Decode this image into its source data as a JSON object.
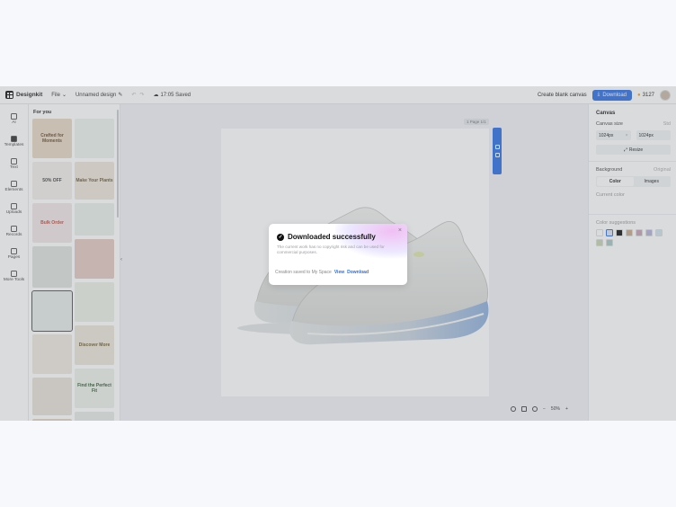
{
  "topbar": {
    "brand": "Designkit",
    "file_menu": "File",
    "doc_title": "Unnamed design",
    "save_status": "17:05 Saved",
    "create_blank": "Create blank canvas",
    "download": "Download",
    "credits": "3127"
  },
  "rail": {
    "items": [
      {
        "label": "AI",
        "icon": "ai-icon"
      },
      {
        "label": "Templates",
        "icon": "templates-icon"
      },
      {
        "label": "Text",
        "icon": "text-icon"
      },
      {
        "label": "Elements",
        "icon": "elements-icon"
      },
      {
        "label": "Uploads",
        "icon": "upload-icon"
      },
      {
        "label": "Records",
        "icon": "records-icon"
      },
      {
        "label": "Pages",
        "icon": "pages-icon"
      },
      {
        "label": "More Tools",
        "icon": "more-tools-icon"
      }
    ]
  },
  "panel": {
    "title": "For you",
    "thumbs": [
      {
        "text": "Crafted for Moments",
        "color": "#e8d9c4",
        "fg": "#6b4a2e"
      },
      {
        "text": "",
        "color": "#eef3ee",
        "fg": "#4b6b4f"
      },
      {
        "text": "50% OFF",
        "color": "#f3efe9",
        "fg": "#444"
      },
      {
        "text": "Make Your Plants",
        "color": "#efe7da",
        "fg": "#6b5a3a"
      },
      {
        "text": "Bulk Order",
        "color": "#f2e6e6",
        "fg": "#c84a3a"
      },
      {
        "text": "",
        "color": "#eaf0ea",
        "fg": "#3c5c3c"
      },
      {
        "text": "",
        "color": "#dfe3e0",
        "fg": "#333"
      },
      {
        "text": "",
        "color": "#e4c9c0",
        "fg": "#333"
      },
      {
        "text": "",
        "color": "#e6ece9",
        "fg": "#333"
      },
      {
        "text": "",
        "color": "#eef0e6",
        "fg": "#3b5a3b"
      },
      {
        "text": "",
        "color": "#f0e8de",
        "fg": "#6b3a2a"
      },
      {
        "text": "Discover More",
        "color": "#ece6da",
        "fg": "#6b5a2a"
      },
      {
        "text": "",
        "color": "#e9e2d8",
        "fg": "#333"
      },
      {
        "text": "Find the Perfect Fit",
        "color": "#eef2ea",
        "fg": "#2e5a2e"
      },
      {
        "text": "",
        "color": "#e4d6c4",
        "fg": "#6b4a2e"
      },
      {
        "text": "",
        "color": "#e8ece6",
        "fg": "#333"
      }
    ]
  },
  "stage": {
    "page_label": "1 Page 1/1",
    "zoom": "50%"
  },
  "rpanel": {
    "title": "Canvas",
    "canvas_size_label": "Canvas size",
    "canvas_size_unit": "Std",
    "width_value": "1024px",
    "height_value": "1024px",
    "resize": "Resize",
    "background_label": "Background",
    "background_original": "Original",
    "tab_color": "Color",
    "tab_images": "Images",
    "current_color": "Current color",
    "suggestions_label": "Color suggestions",
    "swatches": [
      "#ffffff",
      "#dfe6f5",
      "#111111",
      "#c9a98a",
      "#c8a3b6",
      "#b7b2dc",
      "#cfe3f0",
      "#c6d6b0",
      "#a8c8c4"
    ]
  },
  "modal": {
    "title": "Downloaded successfully",
    "description": "The current work has no copyright risk and can be used for commercial purposes.",
    "footer_text": "Creation saved to My Space",
    "view_link": "View",
    "download_link": "Download"
  }
}
